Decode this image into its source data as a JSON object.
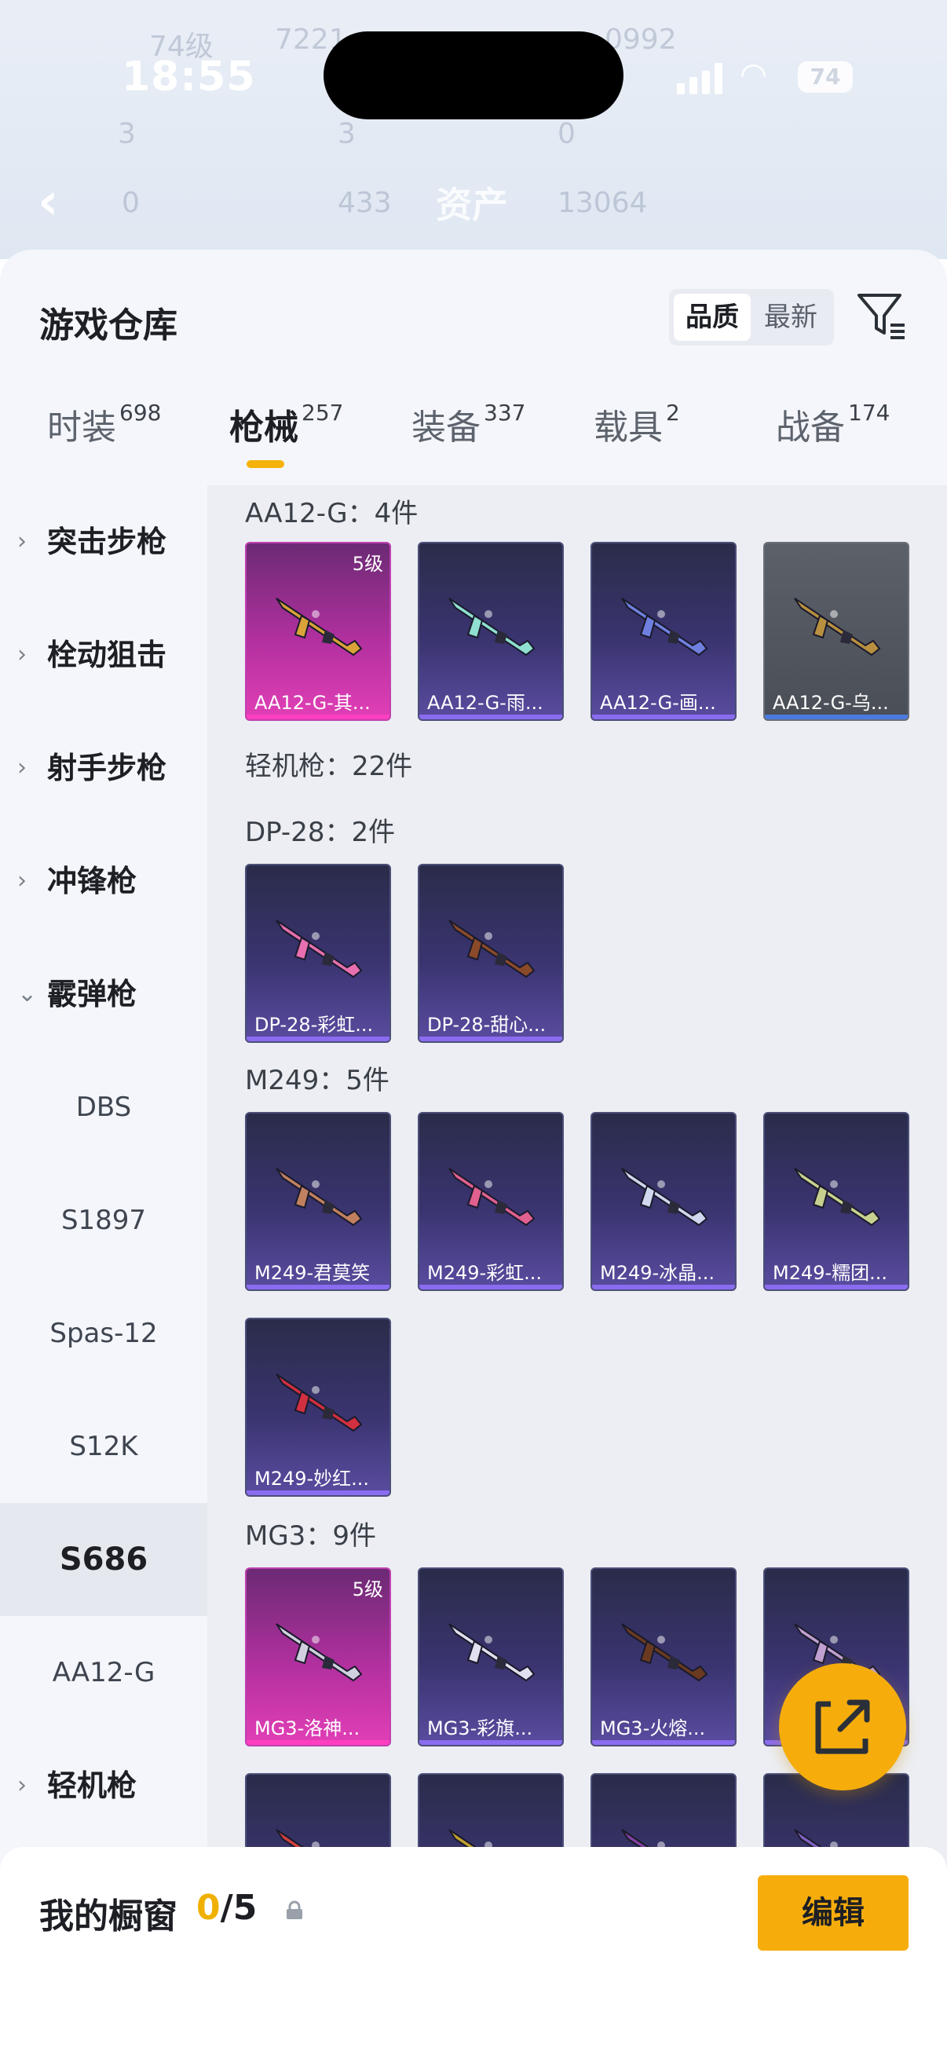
{
  "status_bar": {
    "time": "18:55",
    "battery": "74"
  },
  "background": {
    "ghost_texts": [
      "74级",
      "7221",
      "3",
      "3",
      "0",
      "0",
      "433",
      "13064",
      "0992"
    ],
    "asset_title": "资产"
  },
  "header": {
    "title": "游戏仓库",
    "sort_quality": "品质",
    "sort_newest": "最新"
  },
  "tabs": [
    {
      "label": "时装",
      "count": "698"
    },
    {
      "label": "枪械",
      "count": "257"
    },
    {
      "label": "装备",
      "count": "337"
    },
    {
      "label": "载具",
      "count": "2"
    },
    {
      "label": "战备",
      "count": "174"
    }
  ],
  "sidebar": {
    "items": [
      {
        "label": "突击步枪",
        "type": "group"
      },
      {
        "label": "栓动狙击",
        "type": "group"
      },
      {
        "label": "射手步枪",
        "type": "group"
      },
      {
        "label": "冲锋枪",
        "type": "group"
      },
      {
        "label": "霰弹枪",
        "type": "group-open"
      },
      {
        "label": "DBS",
        "type": "sub"
      },
      {
        "label": "S1897",
        "type": "sub"
      },
      {
        "label": "Spas-12",
        "type": "sub"
      },
      {
        "label": "S12K",
        "type": "sub"
      },
      {
        "label": "S686",
        "type": "selected"
      },
      {
        "label": "AA12-G",
        "type": "sub"
      },
      {
        "label": "轻机枪",
        "type": "group"
      }
    ]
  },
  "content": {
    "sections": [
      {
        "title": "AA12-G：4件"
      },
      {
        "title": "轻机枪：22件"
      },
      {
        "title": "DP-28：2件"
      },
      {
        "title": "M249：5件"
      },
      {
        "title": "MG3：9件"
      }
    ],
    "cards": [
      {
        "name": "AA12-G-其...",
        "level": "5级",
        "style": "pink"
      },
      {
        "name": "AA12-G-雨...",
        "level": "",
        "style": "purple"
      },
      {
        "name": "AA12-G-画...",
        "level": "",
        "style": "purple"
      },
      {
        "name": "AA12-G-乌...",
        "level": "",
        "style": "gray"
      },
      {
        "name": "DP-28-彩虹...",
        "level": "",
        "style": "purple"
      },
      {
        "name": "DP-28-甜心...",
        "level": "",
        "style": "purple"
      },
      {
        "name": "M249-君莫笑",
        "level": "",
        "style": "purple"
      },
      {
        "name": "M249-彩虹...",
        "level": "",
        "style": "purple"
      },
      {
        "name": "M249-冰晶...",
        "level": "",
        "style": "purple"
      },
      {
        "name": "M249-糯团...",
        "level": "",
        "style": "purple"
      },
      {
        "name": "M249-妙红...",
        "level": "",
        "style": "purple"
      },
      {
        "name": "MG3-洛神...",
        "level": "5级",
        "style": "pink"
      },
      {
        "name": "MG3-彩旗...",
        "level": "",
        "style": "purple"
      },
      {
        "name": "MG3-火熔...",
        "level": "",
        "style": "purple"
      },
      {
        "name": "",
        "level": "",
        "style": "purple"
      },
      {
        "name": "",
        "level": "",
        "style": "purple"
      },
      {
        "name": "",
        "level": "",
        "style": "purple"
      },
      {
        "name": "",
        "level": "",
        "style": "purple"
      },
      {
        "name": "",
        "level": "",
        "style": "purple"
      }
    ]
  },
  "footer": {
    "label": "我的橱窗",
    "count_current": "0",
    "count_total": "/5",
    "edit_label": "编辑"
  },
  "colors": {
    "accent": "#f6ad0c",
    "sheet_bg": "#f4f6fb",
    "content_bg": "#eceef3"
  },
  "icons": [
    "back-arrow-icon",
    "filter-icon",
    "chevron-right-icon",
    "chevron-down-icon",
    "lock-icon",
    "share-icon"
  ]
}
